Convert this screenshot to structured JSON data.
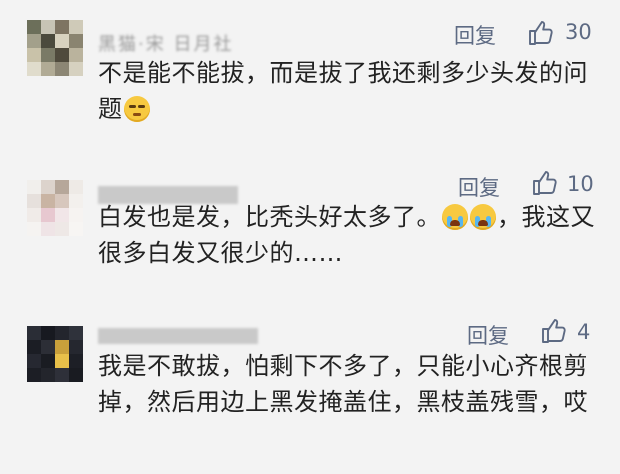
{
  "comments": [
    {
      "name": "黑猫·宋 日月社",
      "reply_label": "回复",
      "like_icon": "thumbs-up-icon",
      "likes": "30",
      "text": "不是能不能拔，而是拔了我还剩多少头发的问题",
      "emoji": "😒"
    },
    {
      "name": "",
      "reply_label": "回复",
      "like_icon": "thumbs-up-icon",
      "likes": "10",
      "text_1": "白发也是发，比秃头好太多了。",
      "emoji": "😭😭",
      "text_2": "，我这又很多白发又很少的……"
    },
    {
      "name": "",
      "reply_label": "回复",
      "like_icon": "thumbs-up-icon",
      "likes": "4",
      "text": "我是不敢拔，怕剩下不多了，只能小心齐根剪掉，然后用边上黑发掩盖住，黑枝盖残雪，哎"
    }
  ],
  "colors": {
    "background": "#f3f3f3",
    "action_text": "#5d6a83",
    "body_text": "#222222"
  }
}
